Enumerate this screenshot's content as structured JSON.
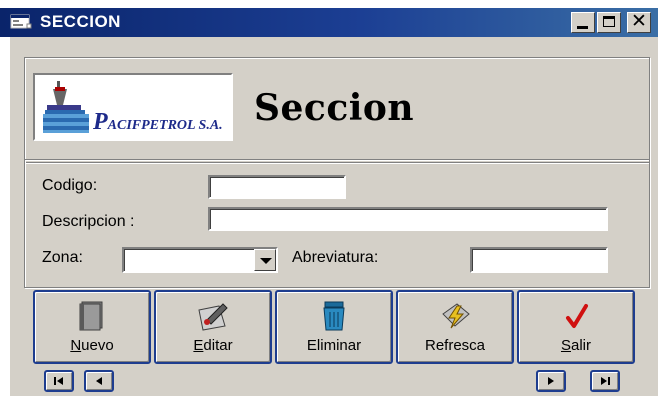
{
  "window": {
    "title": "SECCION",
    "controls": {
      "minimize": "minimize",
      "maximize": "maximize",
      "close": "close"
    }
  },
  "header": {
    "logo": {
      "initial": "P",
      "rest": "ACIFPETROL S.A."
    },
    "title": "Seccion"
  },
  "form": {
    "codigo_label": "Codigo:",
    "codigo_value": "",
    "descripcion_label": "Descripcion :",
    "descripcion_value": "",
    "zona_label": "Zona:",
    "zona_value": "",
    "abreviatura_label": "Abreviatura:",
    "abreviatura_value": ""
  },
  "actions": [
    {
      "accel": "N",
      "rest": "uevo",
      "icon": "new-document-icon"
    },
    {
      "accel": "E",
      "rest": "ditar",
      "icon": "edit-pencil-icon"
    },
    {
      "accel": "",
      "rest": "Eliminar",
      "icon": "trash-bin-icon"
    },
    {
      "accel": "",
      "rest": "Refresca",
      "icon": "lightning-refresh-icon"
    },
    {
      "accel": "S",
      "rest": "alir",
      "icon": "checkmark-icon"
    }
  ],
  "navigation": {
    "icons": [
      "first-record-icon",
      "previous-record-icon",
      "next-record-icon",
      "last-record-icon"
    ]
  },
  "colors": {
    "titlebar": "#0a246a",
    "face": "#d4d0c8",
    "button_border": "#1e3d8f",
    "logo_text": "#1d2a8a"
  }
}
